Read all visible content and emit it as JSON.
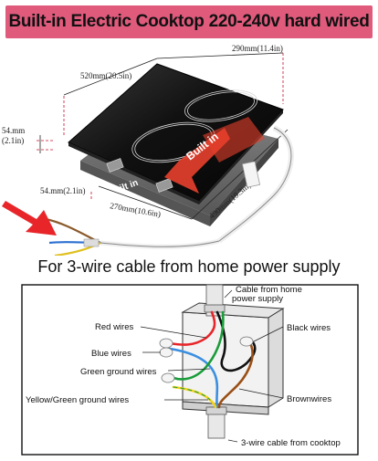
{
  "banner": {
    "title": "Built-in Electric Cooktop 220-240v hard wired",
    "color": "#e05a7c"
  },
  "cooktop_diagram": {
    "dims": {
      "width_front": "520mm(20.5in)",
      "width_back": "290mm(11.4in)",
      "height_left": "54.mm",
      "height_left_in": "(2.1in)",
      "depth_left": "54.mm(2.1in)",
      "depth_front": "270mm(10.6in)",
      "depth_right": "490mm(19.3in)"
    },
    "badge_text": "Built in",
    "badge_color": "#e8402c"
  },
  "subtitle": "For 3-wire cable from home power supply",
  "wiring_diagram": {
    "labels": {
      "cable_home": "Cable from home power supply",
      "red": "Red wires",
      "black": "Black wires",
      "blue": "Blue wires",
      "green": "Green ground wires",
      "yellow_green": "Yellow/Green ground wires",
      "brown": "Brownwires",
      "cable_cooktop": "3-wire cable from cooktop"
    },
    "wire_colors": {
      "red": "#e8262a",
      "black": "#111111",
      "blue": "#3b8fe0",
      "green": "#1a9c3a",
      "yellow": "#f0d21e",
      "brown": "#9a4f16"
    }
  }
}
